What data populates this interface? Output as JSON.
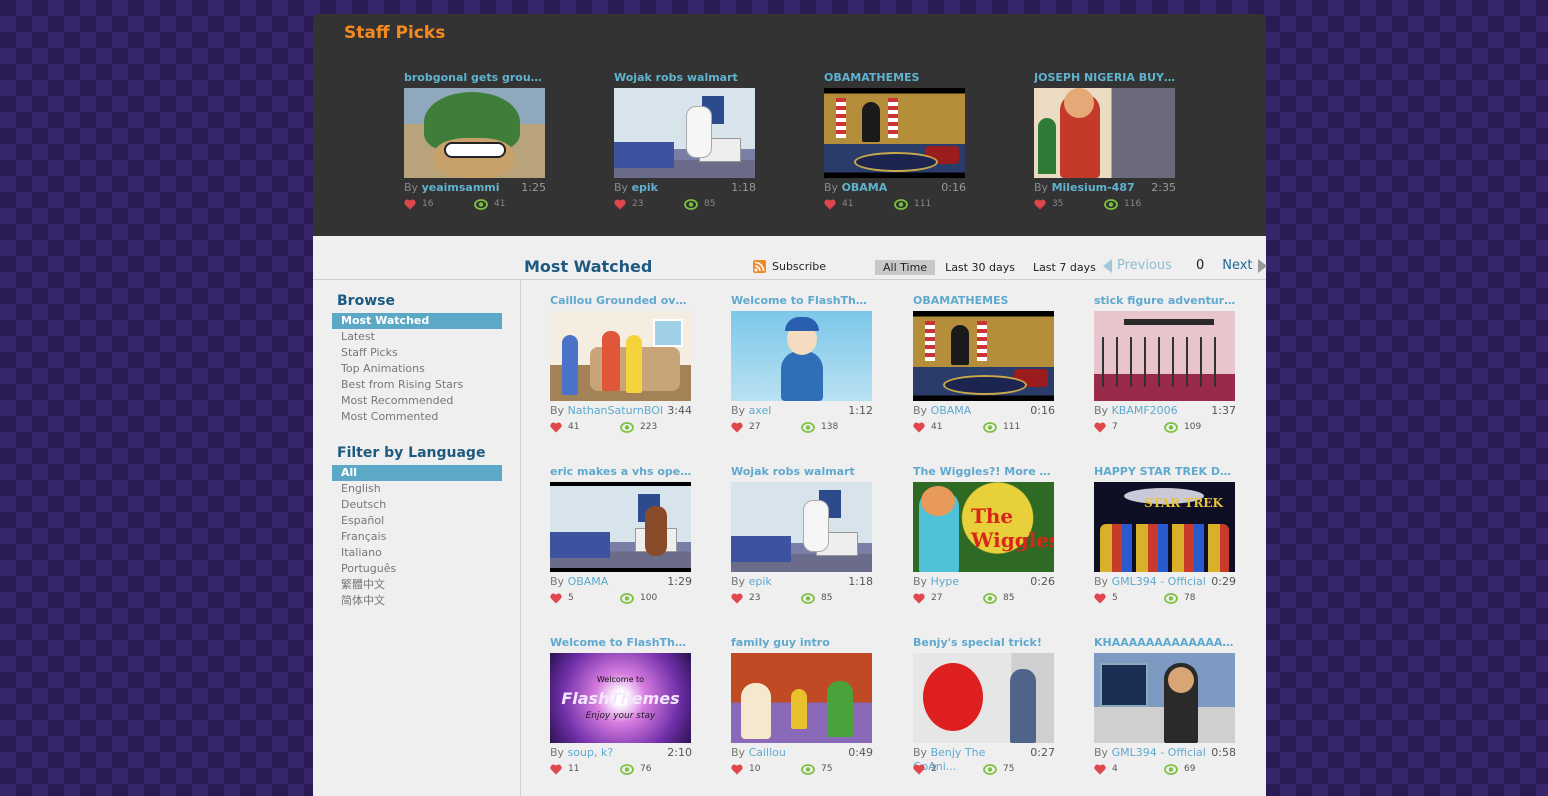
{
  "staff_picks": {
    "title": "Staff Picks",
    "items": [
      {
        "title": "brobgonal gets grounded",
        "by": "By",
        "author": "yeaimsammi",
        "duration": "1:25",
        "likes": "16",
        "views": "41"
      },
      {
        "title": "Wojak robs walmart",
        "by": "By",
        "author": "epik",
        "duration": "1:18",
        "likes": "23",
        "views": "85"
      },
      {
        "title": "OBAMATHEMES",
        "by": "By",
        "author": "OBAMA",
        "duration": "0:16",
        "likes": "41",
        "views": "111"
      },
      {
        "title": "JOSEPH NIGERIA BUYS S...",
        "by": "By",
        "author": "Milesium-487",
        "duration": "2:35",
        "likes": "35",
        "views": "116"
      }
    ]
  },
  "header": {
    "title": "Most Watched",
    "subscribe": "Subscribe",
    "tabs": [
      "All Time",
      "Last 30 days",
      "Last 7 days"
    ],
    "previous": "Previous",
    "page": "0",
    "next": "Next"
  },
  "sidebar": {
    "browse_title": "Browse",
    "browse": [
      "Most Watched",
      "Latest",
      "Staff Picks",
      "Top Animations",
      "Best from Rising Stars",
      "Most Recommended",
      "Most Commented"
    ],
    "filter_title": "Filter by Language",
    "languages": [
      "All",
      "English",
      "Deutsch",
      "Español",
      "Français",
      "Italiano",
      "Português",
      "繁體中文",
      "简体中文"
    ]
  },
  "videos": [
    {
      "title": "Caillou Grounded over th...",
      "by": "By",
      "author": "NathanSaturnBOI",
      "duration": "3:44",
      "likes": "41",
      "views": "223"
    },
    {
      "title": "Welcome to FlashThemes!",
      "by": "By",
      "author": "axel",
      "duration": "1:12",
      "likes": "27",
      "views": "138"
    },
    {
      "title": "OBAMATHEMES",
      "by": "By",
      "author": "OBAMA",
      "duration": "0:16",
      "likes": "41",
      "views": "111"
    },
    {
      "title": "stick figure adventure!",
      "by": "By",
      "author": "KBAMF2006",
      "duration": "1:37",
      "likes": "7",
      "views": "109"
    },
    {
      "title": "eric makes a vhs opening...",
      "by": "By",
      "author": "OBAMA",
      "duration": "1:29",
      "likes": "5",
      "views": "100"
    },
    {
      "title": "Wojak robs walmart",
      "by": "By",
      "author": "epik",
      "duration": "1:18",
      "likes": "23",
      "views": "85"
    },
    {
      "title": "The Wiggles?! More Like,...",
      "by": "By",
      "author": "Hype",
      "duration": "0:26",
      "likes": "27",
      "views": "85"
    },
    {
      "title": "HAPPY STAR TREK DAY!",
      "by": "By",
      "author": "GML394 - Official",
      "duration": "0:29",
      "likes": "5",
      "views": "78"
    },
    {
      "title": "Welcome to FlashThemes!",
      "by": "By",
      "author": "soup, k?",
      "duration": "2:10",
      "likes": "11",
      "views": "76"
    },
    {
      "title": "family guy intro",
      "by": "By",
      "author": "Caillou",
      "duration": "0:49",
      "likes": "10",
      "views": "75"
    },
    {
      "title": "Benjy's special trick!",
      "by": "By",
      "author": "Benjy The GoAni...",
      "duration": "0:27",
      "likes": "2",
      "views": "75"
    },
    {
      "title": "KHAAAAAAAAAAAAAAAA...",
      "by": "By",
      "author": "GML394 - Official",
      "duration": "0:58",
      "likes": "4",
      "views": "69"
    }
  ],
  "thumb_text": {
    "wiggles_logo": "The Wiggles",
    "startrek": "STAR TREK",
    "flash_welcome": "Welcome to",
    "flash_name": "FlashThemes",
    "flash_enjoy": "Enjoy your stay"
  },
  "colors": {
    "accent_orange": "#f58a1f",
    "link_blue": "#5fa9cf",
    "heart_red": "#e0474c",
    "eye_green": "#7cc242",
    "active_blue": "#5ba9c7"
  },
  "icons": {
    "like": "heart-icon",
    "views": "eye-icon",
    "rss": "rss-icon",
    "prev": "arrow-left-icon",
    "next": "arrow-right-icon"
  }
}
